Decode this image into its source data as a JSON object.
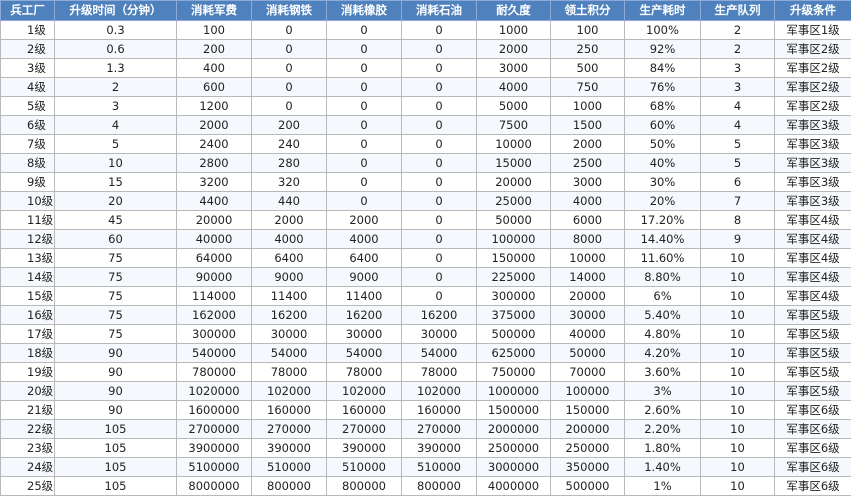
{
  "table": {
    "headers": [
      "兵工厂",
      "升级时间（分钟）",
      "消耗军费",
      "消耗钢铁",
      "消耗橡胶",
      "消耗石油",
      "耐久度",
      "领土积分",
      "生产耗时",
      "生产队列",
      "升级条件"
    ],
    "rows": [
      [
        "1级",
        "0.3",
        "100",
        "0",
        "0",
        "0",
        "1000",
        "100",
        "100%",
        "2",
        "军事区1级"
      ],
      [
        "2级",
        "0.6",
        "200",
        "0",
        "0",
        "0",
        "2000",
        "250",
        "92%",
        "2",
        "军事区2级"
      ],
      [
        "3级",
        "1.3",
        "400",
        "0",
        "0",
        "0",
        "3000",
        "500",
        "84%",
        "3",
        "军事区2级"
      ],
      [
        "4级",
        "2",
        "600",
        "0",
        "0",
        "0",
        "4000",
        "750",
        "76%",
        "3",
        "军事区2级"
      ],
      [
        "5级",
        "3",
        "1200",
        "0",
        "0",
        "0",
        "5000",
        "1000",
        "68%",
        "4",
        "军事区2级"
      ],
      [
        "6级",
        "4",
        "2000",
        "200",
        "0",
        "0",
        "7500",
        "1500",
        "60%",
        "4",
        "军事区3级"
      ],
      [
        "7级",
        "5",
        "2400",
        "240",
        "0",
        "0",
        "10000",
        "2000",
        "50%",
        "5",
        "军事区3级"
      ],
      [
        "8级",
        "10",
        "2800",
        "280",
        "0",
        "0",
        "15000",
        "2500",
        "40%",
        "5",
        "军事区3级"
      ],
      [
        "9级",
        "15",
        "3200",
        "320",
        "0",
        "0",
        "20000",
        "3000",
        "30%",
        "6",
        "军事区3级"
      ],
      [
        "10级",
        "20",
        "4400",
        "440",
        "0",
        "0",
        "25000",
        "4000",
        "20%",
        "7",
        "军事区3级"
      ],
      [
        "11级",
        "45",
        "20000",
        "2000",
        "2000",
        "0",
        "50000",
        "6000",
        "17.20%",
        "8",
        "军事区4级"
      ],
      [
        "12级",
        "60",
        "40000",
        "4000",
        "4000",
        "0",
        "100000",
        "8000",
        "14.40%",
        "9",
        "军事区4级"
      ],
      [
        "13级",
        "75",
        "64000",
        "6400",
        "6400",
        "0",
        "150000",
        "10000",
        "11.60%",
        "10",
        "军事区4级"
      ],
      [
        "14级",
        "75",
        "90000",
        "9000",
        "9000",
        "0",
        "225000",
        "14000",
        "8.80%",
        "10",
        "军事区4级"
      ],
      [
        "15级",
        "75",
        "114000",
        "11400",
        "11400",
        "0",
        "300000",
        "20000",
        "6%",
        "10",
        "军事区4级"
      ],
      [
        "16级",
        "75",
        "162000",
        "16200",
        "16200",
        "16200",
        "375000",
        "30000",
        "5.40%",
        "10",
        "军事区5级"
      ],
      [
        "17级",
        "75",
        "300000",
        "30000",
        "30000",
        "30000",
        "500000",
        "40000",
        "4.80%",
        "10",
        "军事区5级"
      ],
      [
        "18级",
        "90",
        "540000",
        "54000",
        "54000",
        "54000",
        "625000",
        "50000",
        "4.20%",
        "10",
        "军事区5级"
      ],
      [
        "19级",
        "90",
        "780000",
        "78000",
        "78000",
        "78000",
        "750000",
        "70000",
        "3.60%",
        "10",
        "军事区5级"
      ],
      [
        "20级",
        "90",
        "1020000",
        "102000",
        "102000",
        "102000",
        "1000000",
        "100000",
        "3%",
        "10",
        "军事区5级"
      ],
      [
        "21级",
        "90",
        "1600000",
        "160000",
        "160000",
        "160000",
        "1500000",
        "150000",
        "2.60%",
        "10",
        "军事区6级"
      ],
      [
        "22级",
        "105",
        "2700000",
        "270000",
        "270000",
        "270000",
        "2000000",
        "200000",
        "2.20%",
        "10",
        "军事区6级"
      ],
      [
        "23级",
        "105",
        "3900000",
        "390000",
        "390000",
        "390000",
        "2500000",
        "250000",
        "1.80%",
        "10",
        "军事区6级"
      ],
      [
        "24级",
        "105",
        "5100000",
        "510000",
        "510000",
        "510000",
        "3000000",
        "350000",
        "1.40%",
        "10",
        "军事区6级"
      ],
      [
        "25级",
        "105",
        "8000000",
        "800000",
        "800000",
        "800000",
        "4000000",
        "500000",
        "1%",
        "10",
        "军事区6级"
      ]
    ]
  },
  "colors": {
    "header_bg": "#4f81bd",
    "header_text": "#ffffff",
    "grid_line": "#b9b9b9"
  }
}
